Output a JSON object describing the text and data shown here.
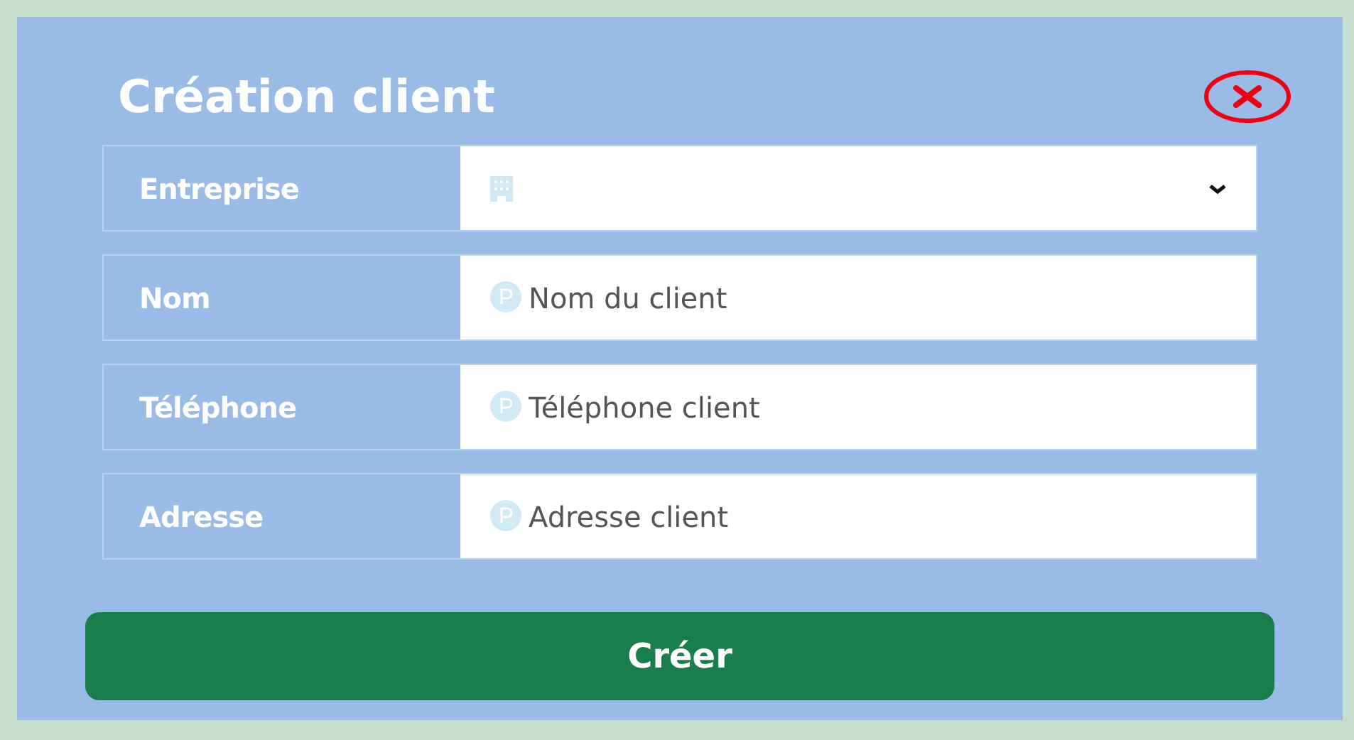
{
  "dialog": {
    "title": "Création client"
  },
  "fields": [
    {
      "kind": "select",
      "label": "Entreprise"
    },
    {
      "kind": "text",
      "label": "Nom",
      "placeholder": "Nom du client"
    },
    {
      "kind": "text",
      "label": "Téléphone",
      "placeholder": "Téléphone client"
    },
    {
      "kind": "text",
      "label": "Adresse",
      "placeholder": "Adresse client"
    }
  ],
  "submit_button": {
    "label": "Créer"
  }
}
